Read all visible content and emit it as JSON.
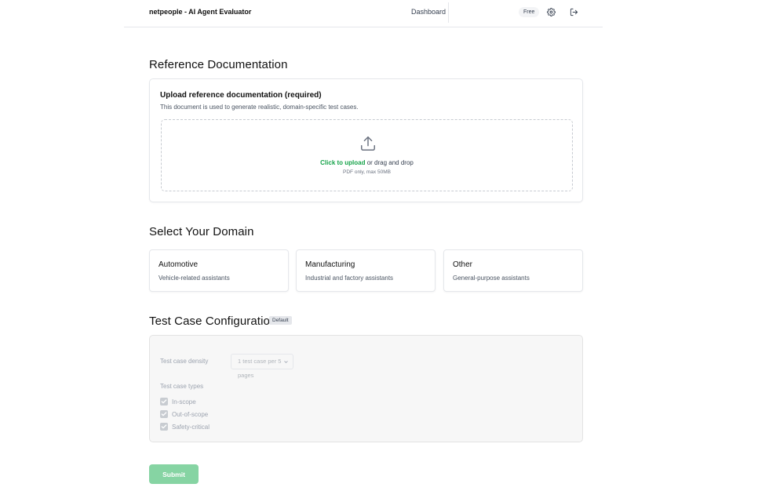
{
  "header": {
    "app_title": "netpeople - AI Agent Evaluator",
    "nav_dashboard": "Dashboard",
    "plan_badge": "Free",
    "icons": [
      "gear-icon",
      "logout-icon"
    ]
  },
  "reference": {
    "section_title": "Reference Documentation",
    "upload_title": "Upload reference documentation (required)",
    "upload_desc": "This document is used to generate realistic, domain-specific test cases.",
    "upload_link": "Click to upload",
    "upload_rest": " or drag and drop",
    "upload_hint": "PDF only, max 50MB",
    "icon": "upload-icon"
  },
  "domain": {
    "section_title": "Select Your Domain",
    "options": [
      {
        "name": "Automotive",
        "desc": "Vehicle-related assistants"
      },
      {
        "name": "Manufacturing",
        "desc": "Industrial and factory assistants"
      },
      {
        "name": "Other",
        "desc": "General-purpose assistants"
      }
    ]
  },
  "config": {
    "section_title": "Test Case Configuration",
    "badge": "Default",
    "density_label": "Test case density",
    "density_value": "1 test case per 5 pages",
    "types_label": "Test case types",
    "types": [
      {
        "label": "In-scope",
        "checked": true
      },
      {
        "label": "Out-of-scope",
        "checked": true
      },
      {
        "label": "Safety-critical",
        "checked": true
      }
    ]
  },
  "submit_label": "Submit",
  "colors": {
    "accent": "#16a34a",
    "submit_disabled": "#86d4a3"
  }
}
